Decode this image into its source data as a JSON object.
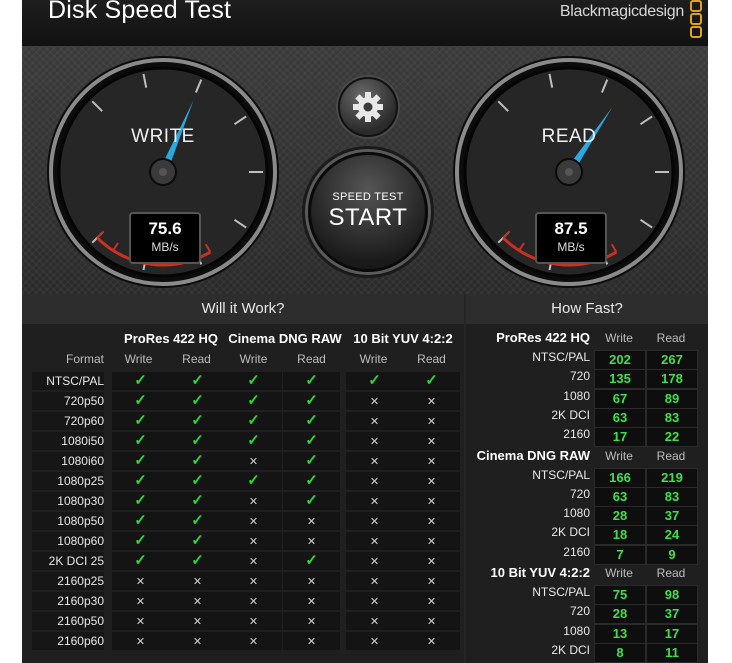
{
  "app": {
    "title": "Disk Speed Test",
    "brand": "Blackmagicdesign"
  },
  "gauges": {
    "write": {
      "label": "WRITE",
      "value": "75.6",
      "unit": "MB/s"
    },
    "read": {
      "label": "READ",
      "value": "87.5",
      "unit": "MB/s"
    }
  },
  "controls": {
    "start_small": "SPEED TEST",
    "start_big": "START",
    "settings_icon": "gear-icon"
  },
  "will_it_work": {
    "title": "Will it Work?",
    "format_header": "Format",
    "groups": [
      "ProRes 422 HQ",
      "Cinema DNG RAW",
      "10 Bit YUV 4:2:2"
    ],
    "col_labels": [
      "Write",
      "Read"
    ],
    "rows": [
      {
        "format": "NTSC/PAL",
        "cells": [
          "ok",
          "ok",
          "ok",
          "ok",
          "ok",
          "ok"
        ]
      },
      {
        "format": "720p50",
        "cells": [
          "ok",
          "ok",
          "ok",
          "ok",
          "no",
          "no"
        ]
      },
      {
        "format": "720p60",
        "cells": [
          "ok",
          "ok",
          "ok",
          "ok",
          "no",
          "no"
        ]
      },
      {
        "format": "1080i50",
        "cells": [
          "ok",
          "ok",
          "ok",
          "ok",
          "no",
          "no"
        ]
      },
      {
        "format": "1080i60",
        "cells": [
          "ok",
          "ok",
          "no",
          "ok",
          "no",
          "no"
        ]
      },
      {
        "format": "1080p25",
        "cells": [
          "ok",
          "ok",
          "ok",
          "ok",
          "no",
          "no"
        ]
      },
      {
        "format": "1080p30",
        "cells": [
          "ok",
          "ok",
          "no",
          "ok",
          "no",
          "no"
        ]
      },
      {
        "format": "1080p50",
        "cells": [
          "ok",
          "ok",
          "no",
          "no",
          "no",
          "no"
        ]
      },
      {
        "format": "1080p60",
        "cells": [
          "ok",
          "ok",
          "no",
          "no",
          "no",
          "no"
        ]
      },
      {
        "format": "2K DCI 25",
        "cells": [
          "ok",
          "ok",
          "no",
          "ok",
          "no",
          "no"
        ]
      },
      {
        "format": "2160p25",
        "cells": [
          "no",
          "no",
          "no",
          "no",
          "no",
          "no"
        ]
      },
      {
        "format": "2160p30",
        "cells": [
          "no",
          "no",
          "no",
          "no",
          "no",
          "no"
        ]
      },
      {
        "format": "2160p50",
        "cells": [
          "no",
          "no",
          "no",
          "no",
          "no",
          "no"
        ]
      },
      {
        "format": "2160p60",
        "cells": [
          "no",
          "no",
          "no",
          "no",
          "no",
          "no"
        ]
      }
    ]
  },
  "how_fast": {
    "title": "How Fast?",
    "col_labels": [
      "Write",
      "Read"
    ],
    "groups": [
      {
        "name": "ProRes 422 HQ",
        "rows": [
          {
            "format": "NTSC/PAL",
            "write": "202",
            "read": "267"
          },
          {
            "format": "720",
            "write": "135",
            "read": "178"
          },
          {
            "format": "1080",
            "write": "67",
            "read": "89"
          },
          {
            "format": "2K DCI",
            "write": "63",
            "read": "83"
          },
          {
            "format": "2160",
            "write": "17",
            "read": "22"
          }
        ]
      },
      {
        "name": "Cinema DNG RAW",
        "rows": [
          {
            "format": "NTSC/PAL",
            "write": "166",
            "read": "219"
          },
          {
            "format": "720",
            "write": "63",
            "read": "83"
          },
          {
            "format": "1080",
            "write": "28",
            "read": "37"
          },
          {
            "format": "2K DCI",
            "write": "18",
            "read": "24"
          },
          {
            "format": "2160",
            "write": "7",
            "read": "9"
          }
        ]
      },
      {
        "name": "10 Bit YUV 4:2:2",
        "rows": [
          {
            "format": "NTSC/PAL",
            "write": "75",
            "read": "98"
          },
          {
            "format": "720",
            "write": "28",
            "read": "37"
          },
          {
            "format": "1080",
            "write": "13",
            "read": "17"
          },
          {
            "format": "2K DCI",
            "write": "8",
            "read": "11"
          }
        ]
      }
    ]
  },
  "colors": {
    "check": "#31d53a",
    "value_green": "#3ee04a",
    "needle": "#2ba8e0",
    "redzone": "#c8321e"
  }
}
